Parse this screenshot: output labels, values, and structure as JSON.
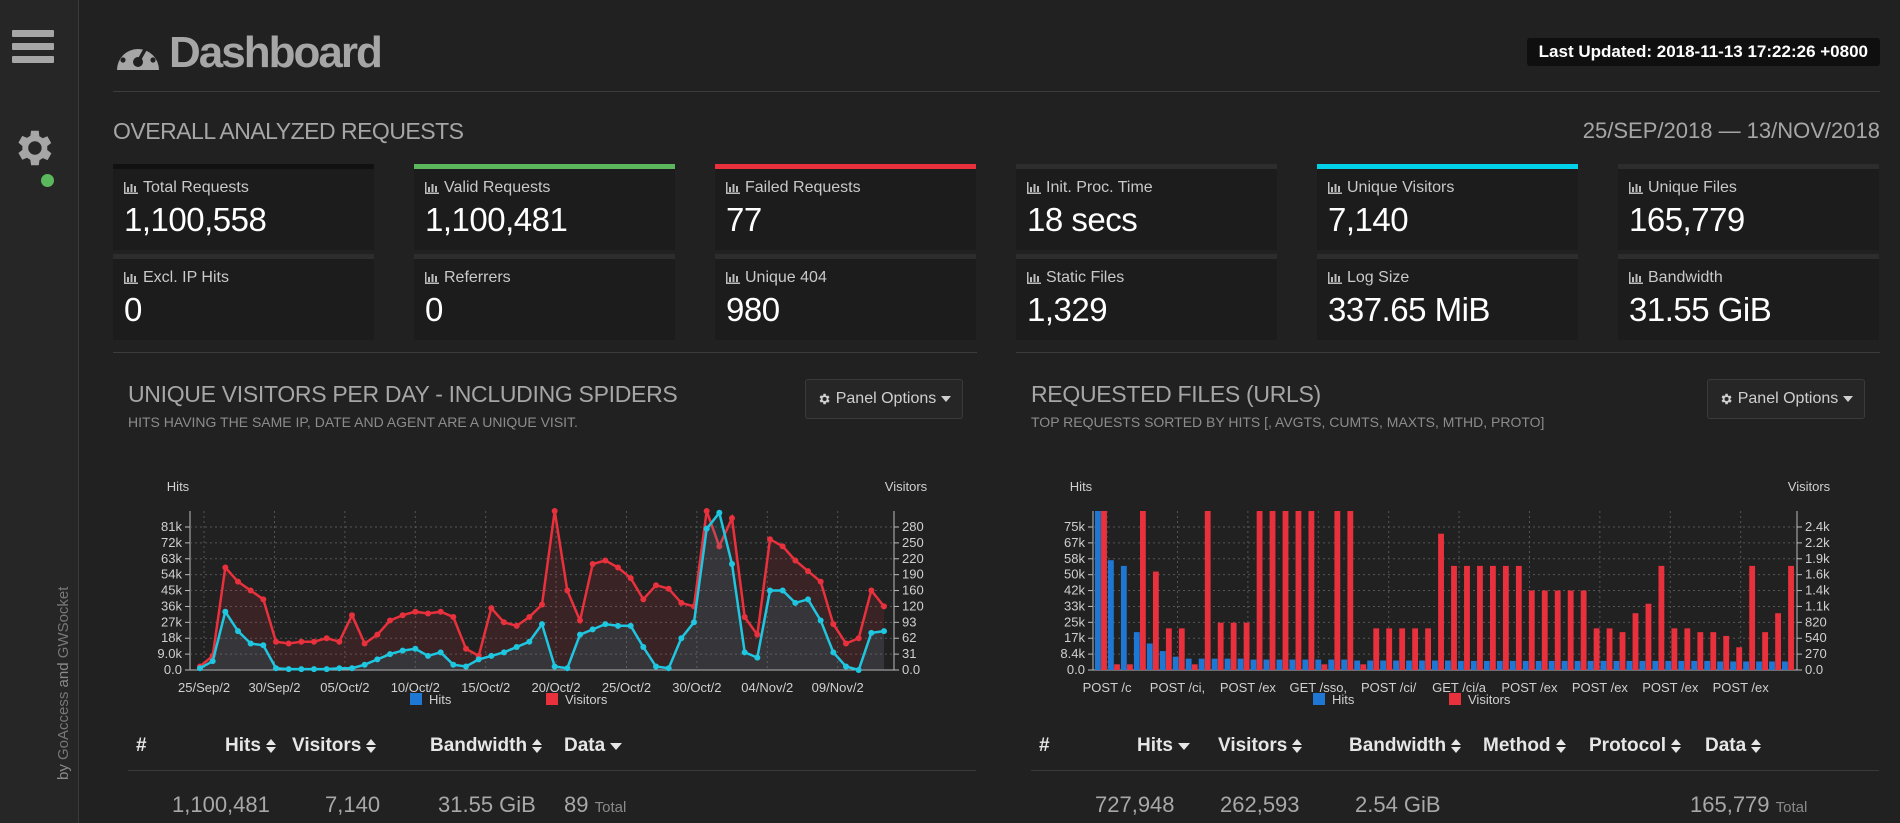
{
  "app": {
    "title": "Dashboard",
    "last_updated": "Last Updated: 2018-11-13 17:22:26 +0800",
    "credit_prefix": "by ",
    "credit_goaccess": "GoAccess",
    "credit_and": " and ",
    "credit_gwsocket": "GWSocket"
  },
  "overall": {
    "title": "OVERALL ANALYZED REQUESTS",
    "date_range": "25/SEP/2018 — 13/NOV/2018",
    "cards": [
      {
        "label": "Total Requests",
        "value": "1,100,558",
        "accent": "#111111"
      },
      {
        "label": "Valid Requests",
        "value": "1,100,481",
        "accent": "#5cb85c"
      },
      {
        "label": "Failed Requests",
        "value": "77",
        "accent": "#e8313c"
      },
      {
        "label": "Init. Proc. Time",
        "value": "18 secs",
        "accent": "#2d2d2d"
      },
      {
        "label": "Unique Visitors",
        "value": "7,140",
        "accent": "#00d0e8"
      },
      {
        "label": "Unique Files",
        "value": "165,779",
        "accent": "#2d2d2d"
      },
      {
        "label": "Excl. IP Hits",
        "value": "0",
        "accent": "#2d2d2d"
      },
      {
        "label": "Referrers",
        "value": "0",
        "accent": "#2d2d2d"
      },
      {
        "label": "Unique 404",
        "value": "980",
        "accent": "#2d2d2d"
      },
      {
        "label": "Static Files",
        "value": "1,329",
        "accent": "#2d2d2d"
      },
      {
        "label": "Log Size",
        "value": "337.65 MiB",
        "accent": "#2d2d2d"
      },
      {
        "label": "Bandwidth",
        "value": "31.55 GiB",
        "accent": "#2d2d2d"
      }
    ]
  },
  "visitors_panel": {
    "title": "UNIQUE VISITORS PER DAY - INCLUDING SPIDERS",
    "subtitle": "HITS HAVING THE SAME IP, DATE AND AGENT ARE A UNIQUE VISIT.",
    "options_label": "Panel Options",
    "table": {
      "headers": [
        "#",
        "Hits",
        "Visitors",
        "Bandwidth",
        "Data"
      ],
      "row": {
        "hits": "1,100,481",
        "visitors": "7,140",
        "bandwidth": "31.55 GiB",
        "data": "89",
        "data_suffix": "Total"
      }
    }
  },
  "requests_panel": {
    "title": "REQUESTED FILES (URLS)",
    "subtitle": "TOP REQUESTS SORTED BY HITS [, AVGTS, CUMTS, MAXTS, MTHD, PROTO]",
    "options_label": "Panel Options",
    "table": {
      "headers": [
        "#",
        "Hits",
        "Visitors",
        "Bandwidth",
        "Method",
        "Protocol",
        "Data"
      ],
      "row": {
        "hits": "727,948",
        "visitors": "262,593",
        "bandwidth": "2.54 GiB",
        "data": "165,779",
        "data_suffix": "Total"
      }
    }
  },
  "colors": {
    "hits": "#1f77d4",
    "hits_line": "#1fc6e0",
    "visitors": "#e8313c"
  },
  "chart_data": [
    {
      "type": "line",
      "title": "",
      "left_axis_label": "Hits",
      "right_axis_label": "Visitors",
      "left_ticks": [
        "0.0",
        "9.0k",
        "18k",
        "27k",
        "36k",
        "45k",
        "54k",
        "63k",
        "72k",
        "81k"
      ],
      "right_ticks": [
        "0.0",
        "31",
        "62",
        "93",
        "120",
        "160",
        "190",
        "220",
        "250",
        "280"
      ],
      "left_max": 90000,
      "right_max": 310,
      "x_ticks": [
        "25/Sep/2",
        "30/Sep/2",
        "05/Oct/2",
        "10/Oct/2",
        "15/Oct/2",
        "20/Oct/2",
        "25/Oct/2",
        "30/Oct/2",
        "04/Nov/2",
        "09/Nov/2"
      ],
      "series": [
        {
          "name": "Hits",
          "axis": "left",
          "values": [
            1000,
            5000,
            33000,
            22000,
            15000,
            14000,
            1000,
            500,
            500,
            500,
            500,
            1000,
            1000,
            3000,
            6000,
            9000,
            11000,
            12000,
            8000,
            10000,
            3000,
            2000,
            6000,
            8000,
            10000,
            13000,
            16000,
            26000,
            2000,
            1000,
            20000,
            23000,
            26000,
            25000,
            25000,
            13000,
            2000,
            1000,
            18000,
            27000,
            80000,
            89000,
            60000,
            10000,
            7000,
            45000,
            45000,
            38000,
            40000,
            28000,
            10000,
            2000,
            0,
            21000,
            22000
          ]
        },
        {
          "name": "Visitors",
          "axis": "left",
          "values": [
            2000,
            8000,
            58000,
            50000,
            45000,
            40000,
            16000,
            15000,
            16000,
            16000,
            18000,
            16000,
            31000,
            15000,
            20000,
            28000,
            31000,
            33000,
            32000,
            33000,
            30000,
            12000,
            8000,
            35000,
            27000,
            25000,
            30000,
            37000,
            90000,
            45000,
            28000,
            60000,
            62000,
            58000,
            52000,
            40000,
            48000,
            46000,
            38000,
            36000,
            90000,
            70000,
            86000,
            30000,
            20000,
            74000,
            70000,
            62000,
            56000,
            50000,
            26000,
            15000,
            18000,
            45000,
            36000
          ]
        }
      ],
      "legend": [
        "Hits",
        "Visitors"
      ]
    },
    {
      "type": "bar",
      "title": "",
      "left_axis_label": "Hits",
      "right_axis_label": "Visitors",
      "left_ticks": [
        "0.0",
        "8.4k",
        "17k",
        "25k",
        "33k",
        "42k",
        "50k",
        "58k",
        "67k",
        "75k"
      ],
      "right_ticks": [
        "0.0",
        "270",
        "540",
        "820",
        "1.1k",
        "1.4k",
        "1.6k",
        "1.9k",
        "2.2k",
        "2.4k"
      ],
      "left_max": 84000,
      "x_ticks": [
        "POST /c",
        "POST /ci,",
        "POST /ex",
        "GET /sso,",
        "POST /ci/",
        "GET /ci/a",
        "POST /ex",
        "POST /ex",
        "POST /ex",
        "POST /ex"
      ],
      "series": [
        {
          "name": "Hits",
          "values": [
            84000,
            58000,
            55000,
            20000,
            14000,
            10000,
            7000,
            6000,
            6000,
            6000,
            6000,
            6000,
            5500,
            5500,
            5500,
            5500,
            5500,
            5500,
            5500,
            5500,
            5000,
            5000,
            5000,
            5000,
            5000,
            5000,
            5000,
            5000,
            4800,
            4800,
            4800,
            4800,
            4800,
            4800,
            4800,
            4800,
            4800,
            4800,
            4800,
            4800,
            4800,
            4800,
            4800,
            4800,
            4800,
            4800,
            4800,
            4800,
            4500,
            4500,
            4500,
            4500,
            4500,
            4500
          ]
        },
        {
          "name": "Visitors",
          "values": [
            84000,
            3000,
            3000,
            84000,
            52000,
            22000,
            22000,
            3000,
            84000,
            25000,
            25000,
            25000,
            84000,
            84000,
            84000,
            84000,
            84000,
            3000,
            84000,
            84000,
            3000,
            22000,
            22000,
            22000,
            22000,
            22000,
            72000,
            55000,
            55000,
            55000,
            55000,
            55000,
            55000,
            42000,
            42000,
            42000,
            42000,
            42000,
            22000,
            22000,
            20000,
            30000,
            35000,
            55000,
            22000,
            22000,
            20000,
            20000,
            18000,
            12000,
            55000,
            20000,
            30000,
            55000
          ]
        }
      ],
      "legend": [
        "Hits",
        "Visitors"
      ]
    }
  ]
}
